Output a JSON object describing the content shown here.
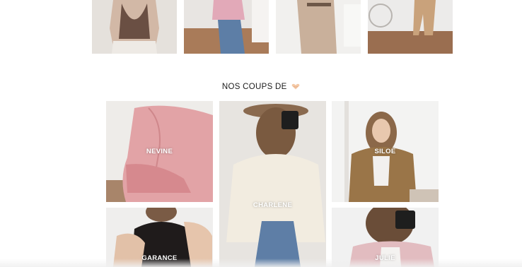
{
  "top_row": [
    {
      "alt": "look-1"
    },
    {
      "alt": "look-2"
    },
    {
      "alt": "look-3"
    },
    {
      "alt": "look-4"
    }
  ],
  "section": {
    "title": "NOS COUPS DE",
    "emoji_icon": "heart-hands-icon"
  },
  "grid": {
    "nevine": "NEVINE",
    "charlene": "CHARLENE",
    "siloe": "SILOE",
    "garance": "GARANCE",
    "julie": "JULIE"
  },
  "colors": {
    "label_text": "#ffffff",
    "title_text": "#1b1b1b",
    "background": "#ffffff"
  }
}
